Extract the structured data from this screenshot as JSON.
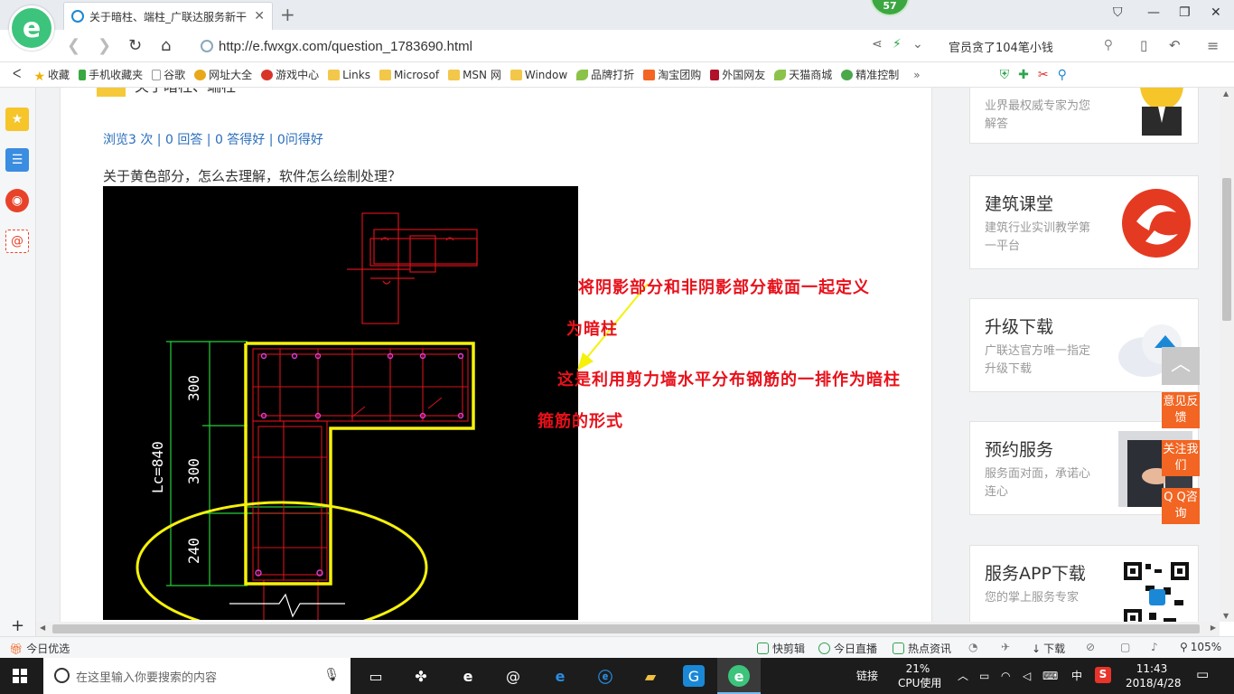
{
  "browser": {
    "tab_title": "关于暗柱、端柱_广联达服务新干",
    "badge": "57",
    "url": "http://e.fwxgx.com/question_1783690.html",
    "search_value": "官员贪了104笔小钱"
  },
  "bookmarks": [
    {
      "label": "收藏",
      "icon": "star-icon"
    },
    {
      "label": "手机收藏夹",
      "icon": "phone-icon"
    },
    {
      "label": "谷歌",
      "icon": "page-icon"
    },
    {
      "label": "网址大全",
      "icon": "globe-icon"
    },
    {
      "label": "游戏中心",
      "icon": "game-icon"
    },
    {
      "label": "Links",
      "icon": "folder-icon"
    },
    {
      "label": "Microsof",
      "icon": "folder-icon"
    },
    {
      "label": "MSN 网",
      "icon": "folder-icon"
    },
    {
      "label": "Window",
      "icon": "folder-icon"
    },
    {
      "label": "品牌打折",
      "icon": "leaf-icon"
    },
    {
      "label": "淘宝团购",
      "icon": "taobao-icon"
    },
    {
      "label": "外国网友",
      "icon": "flag-icon"
    },
    {
      "label": "天猫商城",
      "icon": "leaf-icon"
    },
    {
      "label": "精准控制",
      "icon": "wechat-icon"
    }
  ],
  "page": {
    "title_partial": "关于暗柱、端柱",
    "stats": "浏览3 次 | 0 回答 | 0 答得好 | 0问得好",
    "question": "关于黄色部分，怎么去理解，软件怎么绘制处理？",
    "annotations": {
      "line1": "将阴影部分和非阴影部分截面一起定义",
      "line2": "为暗柱",
      "line3": "这是利用剪力墙水平分布钢筋的一排作为暗柱",
      "line4": "箍筋的形式"
    },
    "cad": {
      "dim_300a": "300",
      "dim_300b": "300",
      "dim_240": "240",
      "dim_lc": "Lc=840",
      "colors": {
        "yellow": "#f5f10a",
        "red": "#d2121c",
        "green": "#22d03a",
        "magenta": "#e23ad6",
        "white": "#ffffff"
      }
    }
  },
  "right_panel": {
    "card0": {
      "desc": "业界最权威专家为您解答"
    },
    "card1": {
      "title": "建筑课堂",
      "desc": "建筑行业实训教学第一平台"
    },
    "card2": {
      "title": "升级下载",
      "desc": "广联达官方唯一指定升级下载"
    },
    "card3": {
      "title": "预约服务",
      "desc": "服务面对面，承诺心连心"
    },
    "card4": {
      "title": "服务APP下载",
      "desc": "您的掌上服务专家"
    }
  },
  "floating": {
    "feedback": "意见反馈",
    "follow": "关注我们",
    "qq": "Q Q咨询"
  },
  "statusbar": {
    "today": "今日优选",
    "items": [
      "快剪辑",
      "今日直播",
      "热点资讯",
      "下载"
    ],
    "zoom": "105%"
  },
  "taskbar": {
    "search_placeholder": "在这里输入你要搜索的内容",
    "link": "链接",
    "cpu_pct": "21%",
    "cpu_label": "CPU使用",
    "ime": "中",
    "time": "11:43",
    "date": "2018/4/28"
  }
}
